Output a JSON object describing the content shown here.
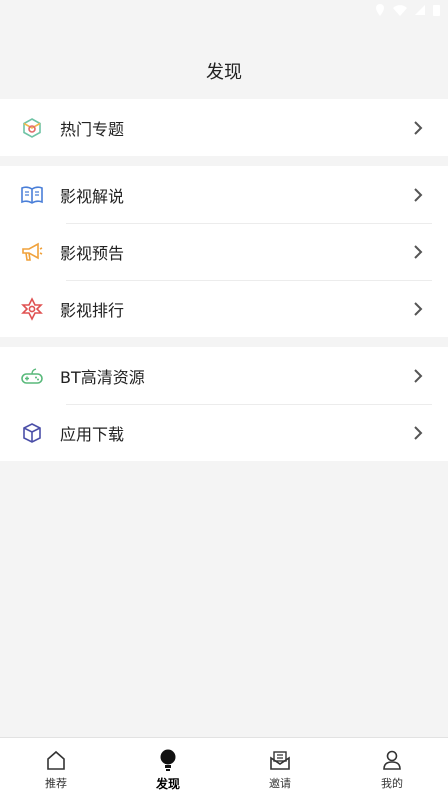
{
  "header": {
    "title": "发现"
  },
  "groups": [
    {
      "items": [
        {
          "label": "热门专题",
          "icon": "topic-icon"
        }
      ]
    },
    {
      "items": [
        {
          "label": "影视解说",
          "icon": "book-icon"
        },
        {
          "label": "影视预告",
          "icon": "megaphone-icon"
        },
        {
          "label": "影视排行",
          "icon": "star-ranking-icon"
        }
      ]
    },
    {
      "items": [
        {
          "label": "BT高清资源",
          "icon": "gamepad-icon"
        },
        {
          "label": "应用下载",
          "icon": "box-icon"
        }
      ]
    }
  ],
  "tabbar": {
    "tabs": [
      {
        "label": "推荐",
        "icon": "home-icon",
        "active": false
      },
      {
        "label": "发现",
        "icon": "bulb-icon",
        "active": true
      },
      {
        "label": "邀请",
        "icon": "envelope-icon",
        "active": false
      },
      {
        "label": "我的",
        "icon": "user-icon",
        "active": false
      }
    ]
  },
  "colors": {
    "background": "#f4f4f4",
    "card": "#ffffff",
    "divider": "#ececec",
    "text": "#222222"
  }
}
